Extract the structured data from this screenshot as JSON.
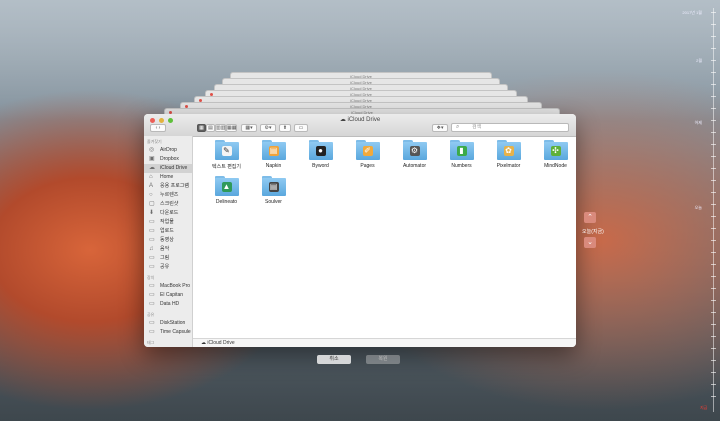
{
  "stack_title": "iCloud Drive",
  "window": {
    "title": "iCloud Drive",
    "toolbar": {
      "view_labels": [
        "",
        "▤",
        "▥▥",
        "▦▦"
      ],
      "arrange": "▦▾",
      "action": "⚙▾",
      "share": "⬆",
      "tag": "▭",
      "dropbox": "❖▾",
      "search_placeholder": "검색"
    }
  },
  "sidebar": {
    "favorites_header": "즐겨찾기",
    "favorites": [
      {
        "label": "AirDrop",
        "icon": "airdrop-icon",
        "glyph": "◎"
      },
      {
        "label": "Dropbox",
        "icon": "dropbox-icon",
        "glyph": "▣"
      },
      {
        "label": "iCloud Drive",
        "icon": "cloud-icon",
        "glyph": "☁",
        "selected": true
      },
      {
        "label": "Home",
        "icon": "home-icon",
        "glyph": "⌂"
      },
      {
        "label": "응용 프로그램",
        "icon": "applications-icon",
        "glyph": "A"
      },
      {
        "label": "누르렌즈",
        "icon": "lens-icon",
        "glyph": "○"
      },
      {
        "label": "스크린샷",
        "icon": "screenshot-icon",
        "glyph": "▢"
      },
      {
        "label": "다운로드",
        "icon": "download-icon",
        "glyph": "⬇"
      },
      {
        "label": "작업물",
        "icon": "folder-icon",
        "glyph": "▭"
      },
      {
        "label": "업로드",
        "icon": "folder-icon",
        "glyph": "▭"
      },
      {
        "label": "동영상",
        "icon": "movies-icon",
        "glyph": "▭"
      },
      {
        "label": "음악",
        "icon": "music-icon",
        "glyph": "♫"
      },
      {
        "label": "그림",
        "icon": "pictures-icon",
        "glyph": "▭"
      },
      {
        "label": "공유",
        "icon": "shared-folder-icon",
        "glyph": "▭"
      }
    ],
    "devices_header": "장치",
    "devices": [
      {
        "label": "MacBook Pro",
        "icon": "laptop-icon",
        "glyph": "▭"
      },
      {
        "label": "El Capitan",
        "icon": "disk-icon",
        "glyph": "▭"
      },
      {
        "label": "Data HD",
        "icon": "disk-icon",
        "glyph": "▭"
      }
    ],
    "shared_header": "공유",
    "shared": [
      {
        "label": "DiskStation",
        "icon": "server-icon",
        "glyph": "▭"
      },
      {
        "label": "Time Capsule",
        "icon": "server-icon",
        "glyph": "▭"
      }
    ],
    "tags_header": "태그"
  },
  "folders": [
    {
      "label": "텍스트 편집기",
      "icon": "textedit-icon",
      "glyph": "✎",
      "color": "#f5f5f5"
    },
    {
      "label": "Napkin",
      "icon": "napkin-icon",
      "glyph": "▤",
      "color": "#f0a33a"
    },
    {
      "label": "Byword",
      "icon": "byword-icon",
      "glyph": "●",
      "color": "#222222"
    },
    {
      "label": "Pages",
      "icon": "pages-icon",
      "glyph": "✐",
      "color": "#f2a93b"
    },
    {
      "label": "Automator",
      "icon": "automator-icon",
      "glyph": "⚙",
      "color": "#555555"
    },
    {
      "label": "Numbers",
      "icon": "numbers-icon",
      "glyph": "▮",
      "color": "#3caa4a"
    },
    {
      "label": "Pixelmator",
      "icon": "pixelmator-icon",
      "glyph": "✿",
      "color": "#e6b24a"
    },
    {
      "label": "MindNode",
      "icon": "mindnode-icon",
      "glyph": "✣",
      "color": "#5fb03a"
    },
    {
      "label": "Delineato",
      "icon": "delineato-icon",
      "glyph": "▲",
      "color": "#2f9a5a"
    },
    {
      "label": "Soulver",
      "icon": "soulver-icon",
      "glyph": "▤",
      "color": "#444444"
    }
  ],
  "pathbar": "iCloud Drive",
  "timeline": {
    "labels": [
      "2017년 1월",
      "2월",
      "어제",
      "오늘"
    ],
    "now": "지금"
  },
  "nav": {
    "up": "⌃",
    "down": "⌄",
    "today": "오늘(지금)"
  },
  "buttons": {
    "cancel": "취소",
    "restore": "복원"
  },
  "colors": {
    "accent_red": "#ff3b30",
    "folder_blue": "#6db4e6",
    "selection": "#d2d2d2"
  }
}
